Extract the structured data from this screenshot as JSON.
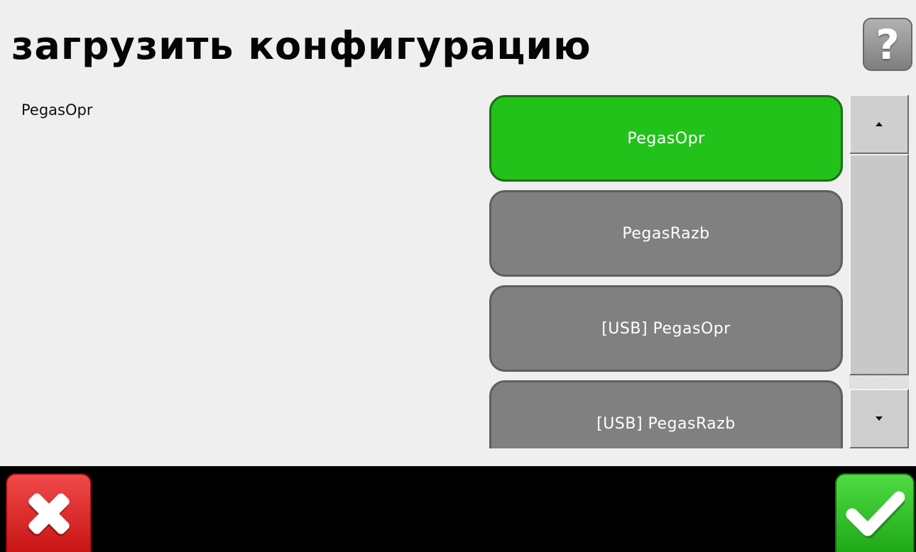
{
  "header": {
    "title": "загрузить конфигурацию",
    "help_label": "?"
  },
  "current_config": {
    "name": "PegasOpr"
  },
  "config_list": {
    "items": [
      {
        "label": "PegasOpr",
        "selected": true
      },
      {
        "label": "PegasRazb",
        "selected": false
      },
      {
        "label": "[USB] PegasOpr",
        "selected": false
      },
      {
        "label": "[USB] PegasRazb",
        "selected": false
      }
    ]
  },
  "icons": {
    "help": "question-mark-icon",
    "scroll_up": "arrow-up-icon",
    "scroll_down": "arrow-down-icon",
    "cancel": "x-icon",
    "confirm": "checkmark-icon"
  },
  "colors": {
    "background": "#efefef",
    "selected_item": "#22c21a",
    "unselected_item": "#808080",
    "cancel_button": "#d92020",
    "confirm_button": "#2dbb22",
    "bottom_bar": "#000000"
  }
}
